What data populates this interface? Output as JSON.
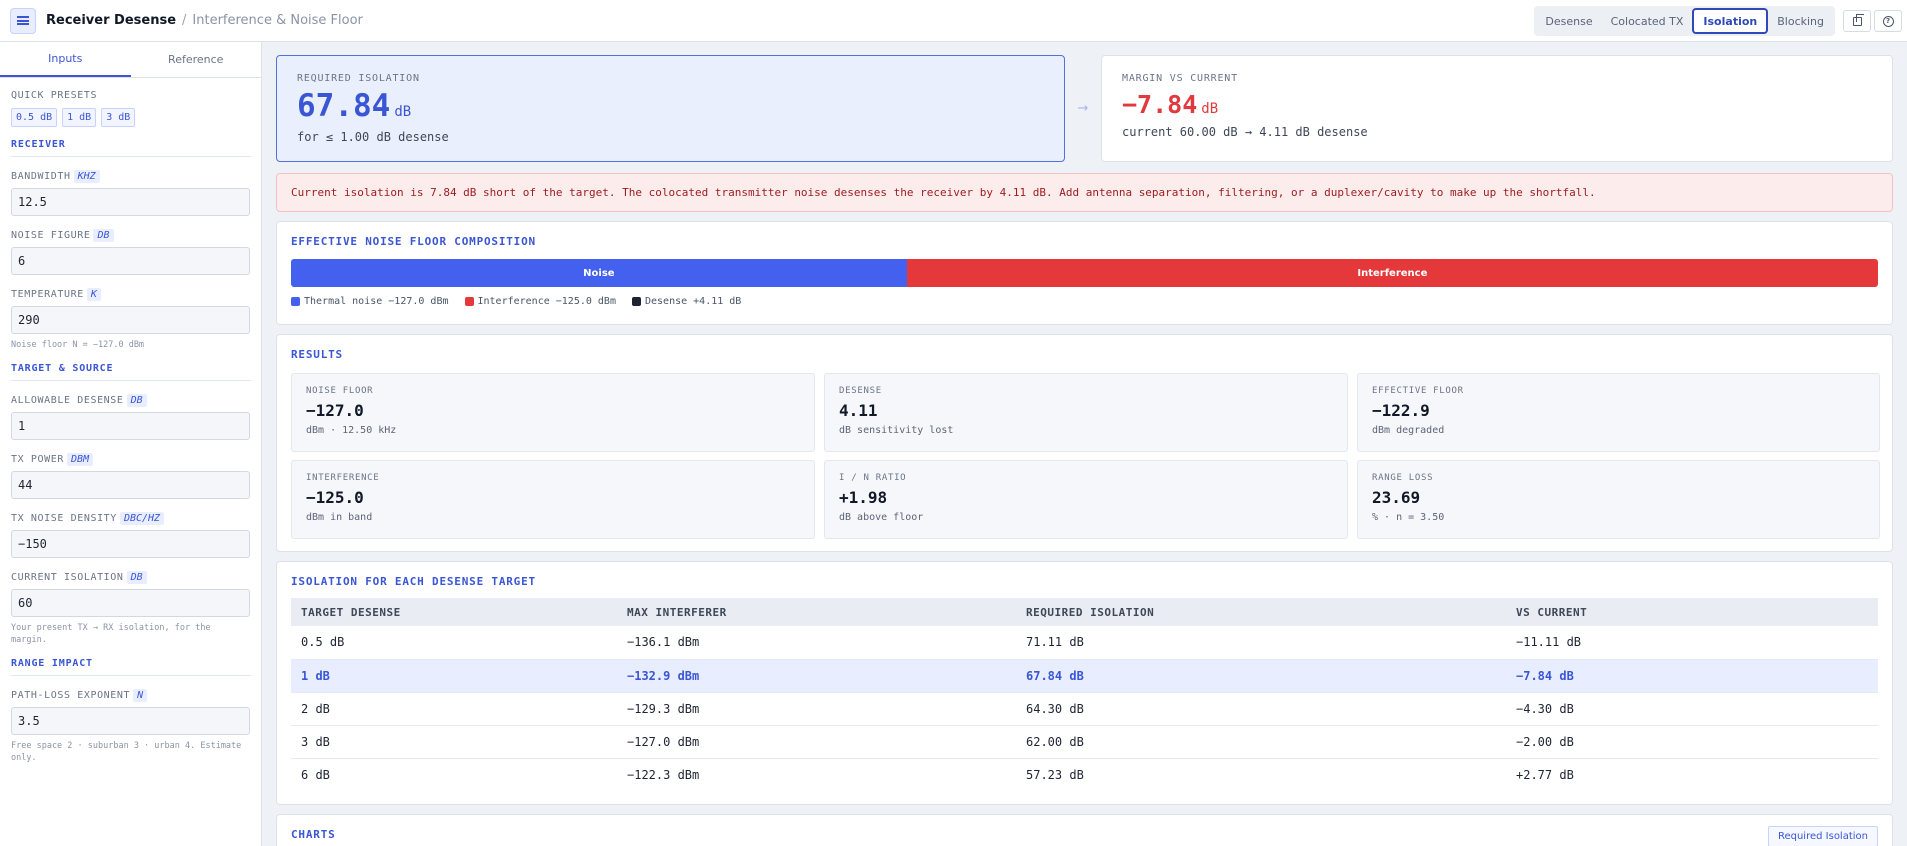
{
  "header": {
    "title": "Receiver Desense",
    "separator": "/",
    "subtitle": "Interference & Noise Floor",
    "tabs": [
      {
        "label": "Desense"
      },
      {
        "label": "Colocated TX"
      },
      {
        "label": "Isolation"
      },
      {
        "label": "Blocking"
      }
    ],
    "active_tab": "Isolation",
    "icons": [
      "menu-icon",
      "copy-icon",
      "help-icon"
    ]
  },
  "sidebar": {
    "tabs": [
      {
        "label": "Inputs"
      },
      {
        "label": "Reference"
      }
    ],
    "quick_presets": {
      "label": "QUICK PRESETS",
      "items": [
        "0.5 dB",
        "1 dB",
        "3 dB"
      ]
    },
    "receiver": {
      "heading": "RECEIVER",
      "bandwidth": {
        "label": "BANDWIDTH",
        "unit": "KHZ",
        "value": "12.5"
      },
      "noise_figure": {
        "label": "NOISE FIGURE",
        "unit": "DB",
        "value": "6"
      },
      "temperature": {
        "label": "TEMPERATURE",
        "unit": "K",
        "value": "290"
      },
      "hint": "Noise floor N = −127.0 dBm"
    },
    "target": {
      "heading": "TARGET & SOURCE",
      "allowable_desense": {
        "label": "ALLOWABLE DESENSE",
        "unit": "DB",
        "value": "1"
      },
      "tx_power": {
        "label": "TX POWER",
        "unit": "DBM",
        "value": "44"
      },
      "tx_noise_density": {
        "label": "TX NOISE DENSITY",
        "unit": "DBC/HZ",
        "value": "−150"
      },
      "current_isolation": {
        "label": "CURRENT ISOLATION",
        "unit": "DB",
        "value": "60"
      },
      "hint": "Your present TX → RX isolation, for the margin."
    },
    "range": {
      "heading": "RANGE IMPACT",
      "path_loss": {
        "label": "PATH-LOSS EXPONENT",
        "unit": "N",
        "value": "3.5"
      },
      "hint": "Free space 2 · suburban 3 · urban 4. Estimate only."
    }
  },
  "summary": {
    "required": {
      "label": "REQUIRED ISOLATION",
      "value": "67.84",
      "unit": "dB",
      "sub": "for ≤ 1.00 dB desense"
    },
    "arrow": "→",
    "margin": {
      "label": "MARGIN VS CURRENT",
      "value": "−7.84",
      "unit": "dB",
      "sub": "current 60.00 dB → 4.11 dB desense"
    }
  },
  "alert": "Current isolation is 7.84 dB short of the target. The colocated transmitter noise desenses the receiver by 4.11 dB. Add antenna separation, filtering, or a duplexer/cavity to make up the shortfall.",
  "composition": {
    "title": "EFFECTIVE NOISE FLOOR COMPOSITION",
    "segments": [
      {
        "label": "Noise",
        "fraction": 0.388,
        "color": "#4361ee"
      },
      {
        "label": "Interference",
        "fraction": 0.612,
        "color": "#e5383b"
      }
    ],
    "legend": [
      {
        "label": "Thermal noise −127.0 dBm",
        "color": "#4361ee"
      },
      {
        "label": "Interference −125.0 dBm",
        "color": "#e5383b"
      },
      {
        "label": "Desense +4.11 dB",
        "color": "#1f2433"
      }
    ]
  },
  "results": {
    "title": "RESULTS",
    "tiles": [
      {
        "label": "NOISE FLOOR",
        "value": "−127.0",
        "sub": "dBm · 12.50 kHz"
      },
      {
        "label": "DESENSE",
        "value": "4.11",
        "sub": "dB sensitivity lost"
      },
      {
        "label": "EFFECTIVE FLOOR",
        "value": "−122.9",
        "sub": "dBm degraded"
      },
      {
        "label": "INTERFERENCE",
        "value": "−125.0",
        "sub": "dBm in band"
      },
      {
        "label": "I / N RATIO",
        "value": "+1.98",
        "sub": "dB above floor"
      },
      {
        "label": "RANGE LOSS",
        "value": "23.69",
        "sub": "% · n = 3.50"
      }
    ]
  },
  "isolation_table": {
    "title": "ISOLATION FOR EACH DESENSE TARGET",
    "columns": [
      "TARGET DESENSE",
      "MAX INTERFERER",
      "REQUIRED ISOLATION",
      "VS CURRENT"
    ],
    "rows": [
      [
        "0.5 dB",
        "−136.1 dBm",
        "71.11 dB",
        "−11.11 dB"
      ],
      [
        "1 dB",
        "−132.9 dBm",
        "67.84 dB",
        "−7.84 dB"
      ],
      [
        "2 dB",
        "−129.3 dBm",
        "64.30 dB",
        "−4.30 dB"
      ],
      [
        "3 dB",
        "−127.0 dBm",
        "62.00 dB",
        "−2.00 dB"
      ],
      [
        "6 dB",
        "−122.3 dBm",
        "57.23 dB",
        "+2.77 dB"
      ]
    ],
    "highlight_row": 1
  },
  "charts": {
    "title": "CHARTS",
    "button": "Required Isolation"
  }
}
